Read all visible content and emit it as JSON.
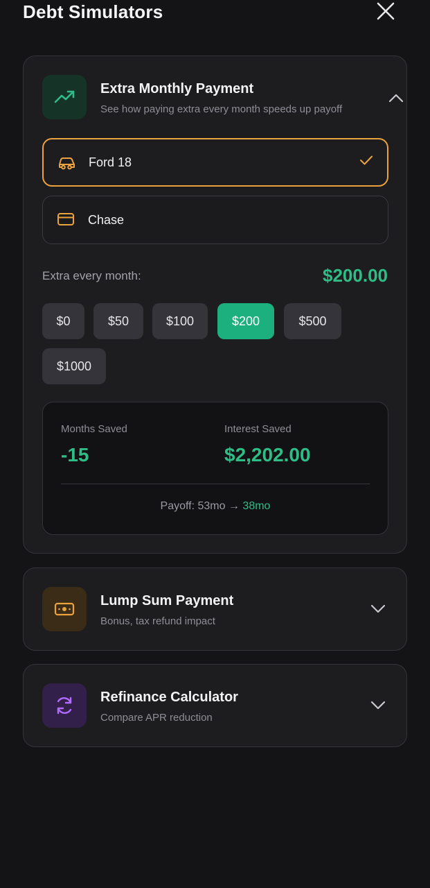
{
  "header": {
    "title": "Debt Simulators"
  },
  "colors": {
    "accent_green": "#2ebd87",
    "selected_border": "#eca33d",
    "chip_active": "#1bb07d"
  },
  "extra_payment": {
    "title": "Extra Monthly Payment",
    "subtitle": "See how paying extra every month speeds up payoff",
    "debts": [
      {
        "label": "Ford 18",
        "icon": "car-icon",
        "selected": true
      },
      {
        "label": "Chase",
        "icon": "credit-card-icon",
        "selected": false
      }
    ],
    "extra_label": "Extra every month:",
    "extra_value": "$200.00",
    "amounts": [
      "$0",
      "$50",
      "$100",
      "$200",
      "$500",
      "$1000"
    ],
    "selected_amount": "$200",
    "results": {
      "months_saved_label": "Months Saved",
      "months_saved_value": "-15",
      "interest_saved_label": "Interest Saved",
      "interest_saved_value": "$2,202.00",
      "payoff_prefix": "Payoff: 53mo →",
      "payoff_to": "38mo"
    }
  },
  "lump_sum": {
    "title": "Lump Sum Payment",
    "subtitle": "Bonus, tax refund impact"
  },
  "refinance": {
    "title": "Refinance Calculator",
    "subtitle": "Compare APR reduction"
  }
}
